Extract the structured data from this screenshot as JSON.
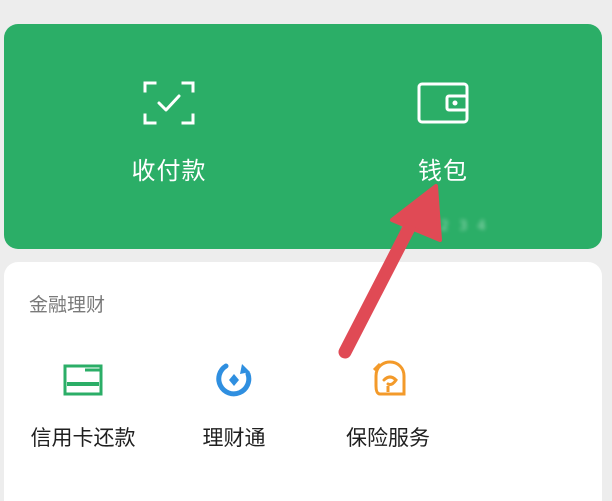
{
  "pay_panel": {
    "pay_receive_label": "收付款",
    "wallet_label": "钱包",
    "blurred_balance": "￥ 1 2 3 4"
  },
  "finance": {
    "title": "金融理财",
    "items": [
      {
        "label": "信用卡还款",
        "icon": "credit-card-icon"
      },
      {
        "label": "理财通",
        "icon": "licaitong-icon"
      },
      {
        "label": "保险服务",
        "icon": "insurance-icon"
      }
    ]
  },
  "colors": {
    "brand_green": "#2bae67",
    "annotation_red": "#e04a55",
    "licaitong_blue": "#2f8fe0",
    "insurance_orange": "#f39a2a"
  }
}
